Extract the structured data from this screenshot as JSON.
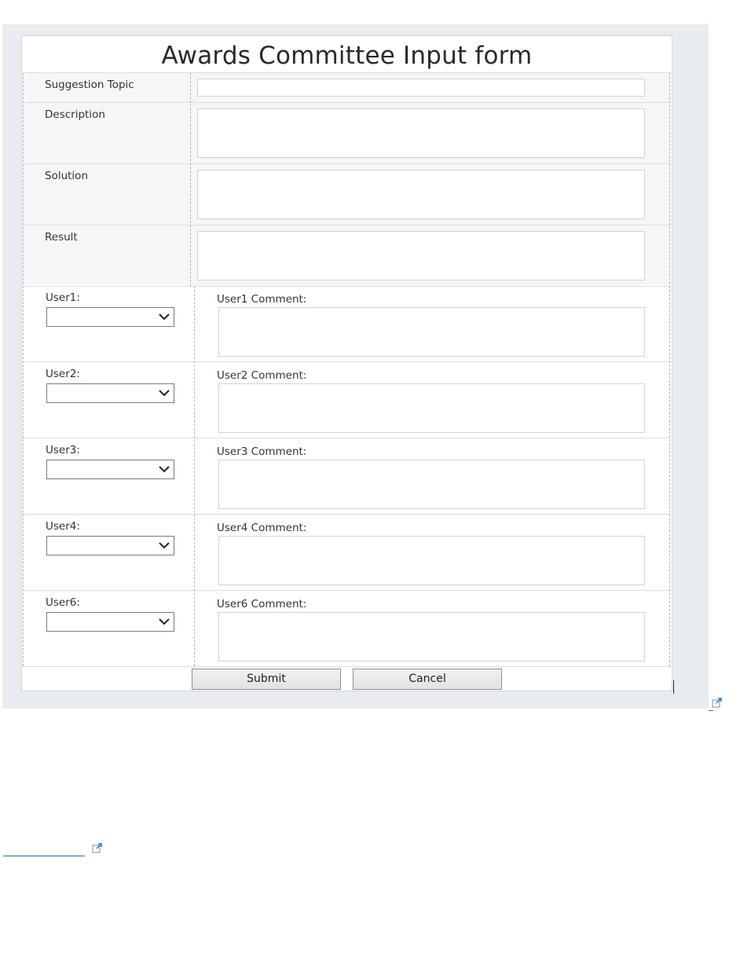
{
  "form": {
    "title": "Awards Committee Input form",
    "fields": {
      "suggestion_topic": "Suggestion Topic",
      "description": "Description",
      "solution": "Solution",
      "result": "Result"
    },
    "users": [
      {
        "label": "User1:",
        "comment_label": "User1 Comment:"
      },
      {
        "label": "User2:",
        "comment_label": "User2 Comment:"
      },
      {
        "label": "User3:",
        "comment_label": "User3 Comment:"
      },
      {
        "label": "User4:",
        "comment_label": "User4 Comment:"
      },
      {
        "label": "User6:",
        "comment_label": "User6 Comment:"
      }
    ],
    "buttons": {
      "submit": "Submit",
      "cancel": "Cancel"
    }
  },
  "icons": {
    "external": "external-link-icon",
    "chevron": "chevron-down-icon"
  },
  "colors": {
    "frame_bg": "#e8ecf1",
    "link": "#1f6fb2"
  }
}
